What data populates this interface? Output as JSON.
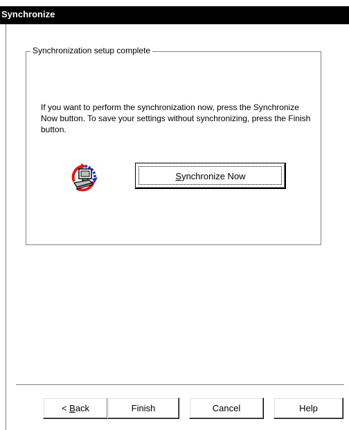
{
  "window": {
    "title": "Synchronize"
  },
  "groupbox": {
    "legend": "Synchronization setup complete"
  },
  "description": {
    "text": "If you want to perform the synchronization now, press the Synchronize Now button. To save your settings without synchronizing, press the Finish button."
  },
  "sync_button": {
    "mnemonic": "S",
    "label_rest": "ynchronize Now",
    "icon": "sync-computer-icon"
  },
  "buttons": {
    "back_prefix": "< ",
    "back_mnemonic": "B",
    "back_rest": "ack",
    "finish": "Finish",
    "cancel": "Cancel",
    "help": "Help"
  },
  "colors": {
    "title_bar": "#000000",
    "icon_arrow_red": "#e01818",
    "icon_arrow_blue": "#1a2fd8"
  }
}
